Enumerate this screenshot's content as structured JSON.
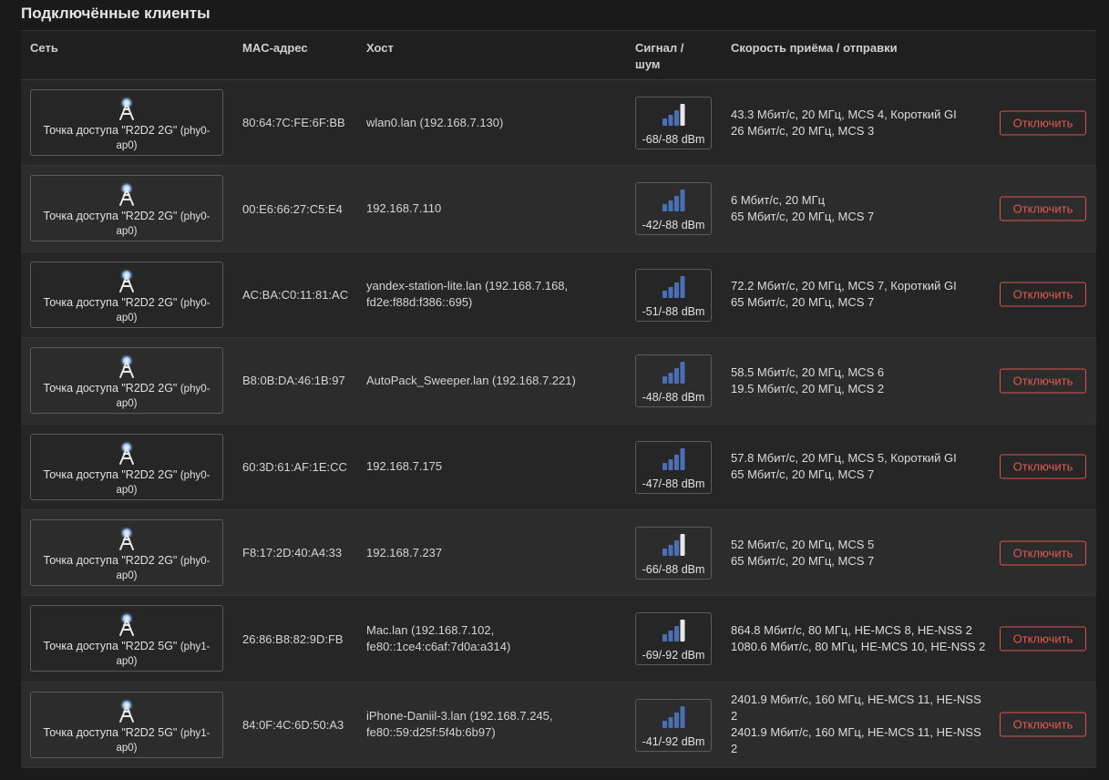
{
  "section": {
    "title": "Подключённые клиенты"
  },
  "columns": {
    "network": "Сеть",
    "mac": "MAC-адрес",
    "host": "Хост",
    "signal_l1": "Сигнал /",
    "signal_l2": "шум",
    "rate": "Скорость приёма / отправки"
  },
  "colors": {
    "accent_danger": "#d9534f",
    "signal_bar": "#4a6fb5",
    "signal_bar_highlight": "#e8e8e8"
  },
  "clients": [
    {
      "network": "Точка доступа \"R2D2 2G\"",
      "radio": "(phy0-ap0)",
      "mac": "80:64:7C:FE:6F:BB",
      "host": "wlan0.lan (192.168.7.130)",
      "signal": "-68/-88 dBm",
      "signal_level": 0.6,
      "rx": "43.3 Мбит/с, 20 МГц, MCS 4, Короткий GI",
      "tx": "26 Мбит/с, 20 МГц, MCS 3",
      "action": "Отключить"
    },
    {
      "network": "Точка доступа \"R2D2 2G\"",
      "radio": "(phy0-ap0)",
      "mac": "00:E6:66:27:C5:E4",
      "host": "192.168.7.110",
      "signal": "-42/-88 dBm",
      "signal_level": 1.0,
      "rx": "6 Мбит/с, 20 МГц",
      "tx": "65 Мбит/с, 20 МГц, MCS 7",
      "action": "Отключить"
    },
    {
      "network": "Точка доступа \"R2D2 2G\"",
      "radio": "(phy0-ap0)",
      "mac": "AC:BA:C0:11:81:AC",
      "host": "yandex-station-lite.lan (192.168.7.168, fd2e:f88d:f386::695)",
      "signal": "-51/-88 dBm",
      "signal_level": 1.0,
      "rx": "72.2 Мбит/с, 20 МГц, MCS 7, Короткий GI",
      "tx": "65 Мбит/с, 20 МГц, MCS 7",
      "action": "Отключить"
    },
    {
      "network": "Точка доступа \"R2D2 2G\"",
      "radio": "(phy0-ap0)",
      "mac": "B8:0B:DA:46:1B:97",
      "host": "AutoPack_Sweeper.lan (192.168.7.221)",
      "signal": "-48/-88 dBm",
      "signal_level": 1.0,
      "rx": "58.5 Мбит/с, 20 МГц, MCS 6",
      "tx": "19.5 Мбит/с, 20 МГц, MCS 2",
      "action": "Отключить"
    },
    {
      "network": "Точка доступа \"R2D2 2G\"",
      "radio": "(phy0-ap0)",
      "mac": "60:3D:61:AF:1E:CC",
      "host": "192.168.7.175",
      "signal": "-47/-88 dBm",
      "signal_level": 1.0,
      "rx": "57.8 Мбит/с, 20 МГц, MCS 5, Короткий GI",
      "tx": "65 Мбит/с, 20 МГц, MCS 7",
      "action": "Отключить"
    },
    {
      "network": "Точка доступа \"R2D2 2G\"",
      "radio": "(phy0-ap0)",
      "mac": "F8:17:2D:40:A4:33",
      "host": "192.168.7.237",
      "signal": "-66/-88 dBm",
      "signal_level": 0.6,
      "rx": "52 Мбит/с, 20 МГц, MCS 5",
      "tx": "65 Мбит/с, 20 МГц, MCS 7",
      "action": "Отключить"
    },
    {
      "network": "Точка доступа \"R2D2 5G\"",
      "radio": "(phy1-ap0)",
      "mac": "26:86:B8:82:9D:FB",
      "host": "Mac.lan (192.168.7.102, fe80::1ce4:c6af:7d0a:a314)",
      "signal": "-69/-92 dBm",
      "signal_level": 0.6,
      "rx": "864.8 Мбит/с, 80 МГц, HE-MCS 8, HE-NSS 2",
      "tx": "1080.6 Мбит/с, 80 МГц, HE-MCS 10, HE-NSS 2",
      "action": "Отключить"
    },
    {
      "network": "Точка доступа \"R2D2 5G\"",
      "radio": "(phy1-ap0)",
      "mac": "84:0F:4C:6D:50:A3",
      "host": "iPhone-Daniil-3.lan (192.168.7.245, fe80::59:d25f:5f4b:6b97)",
      "signal": "-41/-92 dBm",
      "signal_level": 1.0,
      "rx": "2401.9 Мбит/с, 160 МГц, HE-MCS 11, HE-NSS 2",
      "tx": "2401.9 Мбит/с, 160 МГц, HE-MCS 11, HE-NSS 2",
      "action": "Отключить"
    }
  ]
}
